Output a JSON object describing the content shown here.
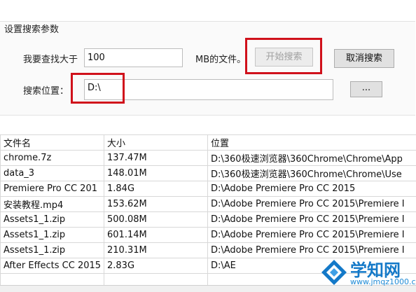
{
  "group": {
    "title": "设置搜索参数"
  },
  "size_filter": {
    "label": "我要查找大于",
    "value": "100",
    "unit_label": "MB的文件。"
  },
  "buttons": {
    "start_search": "开始搜索",
    "cancel_search": "取消搜索",
    "browse": "..."
  },
  "location": {
    "label": "搜索位置：",
    "value": "D:\\"
  },
  "table": {
    "columns": [
      "文件名",
      "大小",
      "位置"
    ],
    "rows": [
      [
        "chrome.7z",
        "137.47M",
        "D:\\360极速浏览器\\360Chrome\\Chrome\\App"
      ],
      [
        "data_3",
        "148.01M",
        "D:\\360极速浏览器\\360Chrome\\Chrome\\Use"
      ],
      [
        "Premiere Pro CC 201",
        "1.84G",
        "D:\\Adobe Premiere Pro CC 2015"
      ],
      [
        "安装教程.mp4",
        "153.62M",
        "D:\\Adobe Premiere Pro CC 2015\\Premiere I"
      ],
      [
        "Assets1_1.zip",
        "500.08M",
        "D:\\Adobe Premiere Pro CC 2015\\Premiere I"
      ],
      [
        "Assets1_1.zip",
        "601.14M",
        "D:\\Adobe Premiere Pro CC 2015\\Premiere I"
      ],
      [
        "Assets1_1.zip",
        "210.31M",
        "D:\\Adobe Premiere Pro CC 2015\\Premiere I"
      ],
      [
        "After Effects CC 2015",
        "2.83G",
        "D:\\AE"
      ],
      [
        "",
        "",
        ""
      ]
    ]
  },
  "watermark": {
    "title": "学知网",
    "url": "www.jmqz1000.com",
    "icon": "blue-diamond-logo-icon"
  },
  "colors": {
    "highlight": "#d0111b",
    "watermark": "#1479c8"
  }
}
